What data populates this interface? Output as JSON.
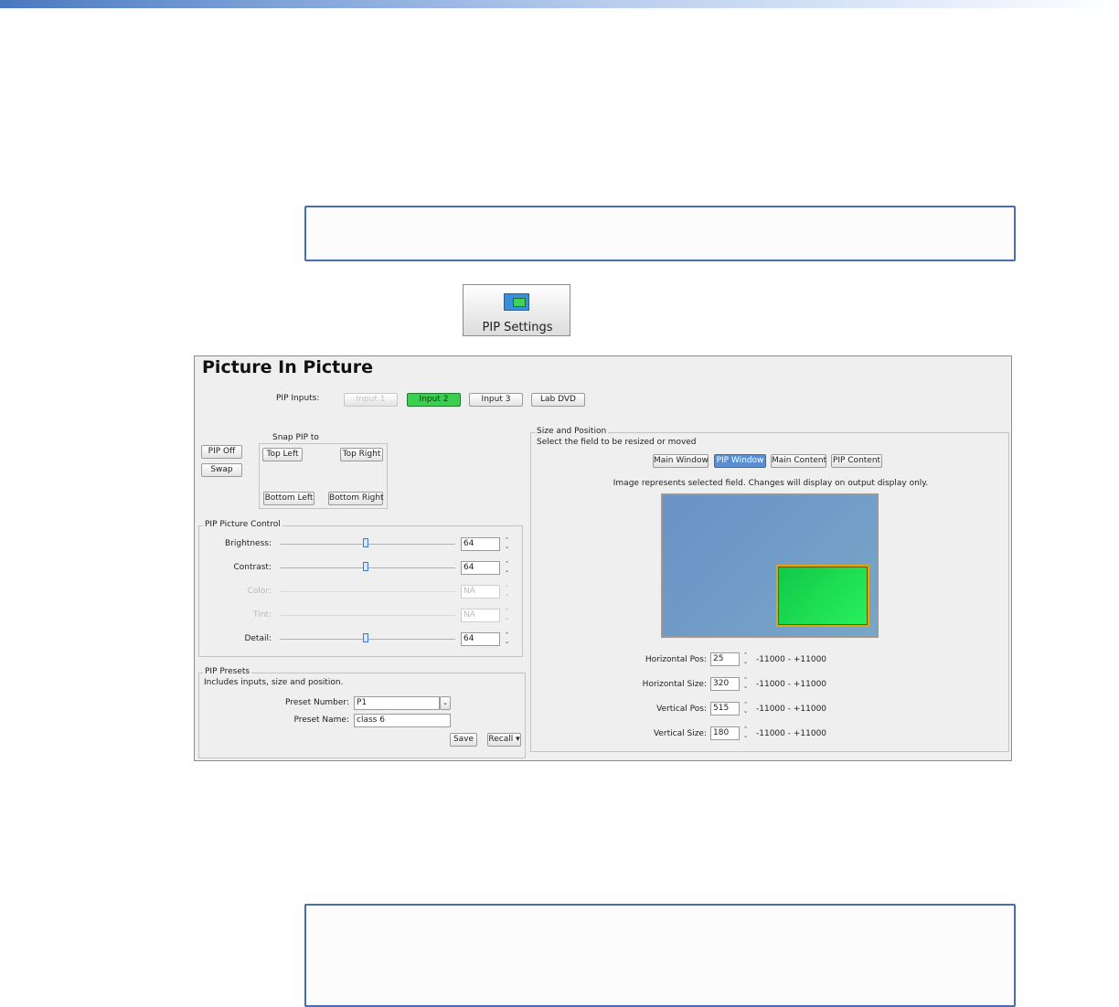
{
  "toolbar": {
    "pip_settings_label": "PIP Settings"
  },
  "panel": {
    "title": "Picture In Picture",
    "pip_inputs_label": "PIP Inputs:",
    "inputs": [
      "Input 1",
      "Input 2",
      "Input 3",
      "Lab DVD"
    ],
    "selected_input": "Input 2",
    "pip_off_label": "PIP Off",
    "swap_label": "Swap",
    "snap_label": "Snap PIP to",
    "snap": {
      "top_left": "Top Left",
      "top_right": "Top Right",
      "bottom_left": "Bottom Left",
      "bottom_right": "Bottom Right"
    },
    "picture_control": {
      "title": "PIP Picture Control",
      "brightness": {
        "label": "Brightness:",
        "value": "64"
      },
      "contrast": {
        "label": "Contrast:",
        "value": "64"
      },
      "color": {
        "label": "Color:",
        "value": "NA"
      },
      "tint": {
        "label": "Tint:",
        "value": "NA"
      },
      "detail": {
        "label": "Detail:",
        "value": "64"
      }
    },
    "presets": {
      "title": "PIP Presets",
      "subtitle": "Includes inputs, size and position.",
      "number_label": "Preset Number:",
      "number_value": "P1",
      "name_label": "Preset Name:",
      "name_value": "class 6",
      "save_label": "Save",
      "recall_label": "Recall ▾"
    },
    "size_position": {
      "title": "Size and Position",
      "subtitle": "Select the field to be resized or moved",
      "tabs": [
        "Main Window",
        "PIP Window",
        "Main Content",
        "PIP Content"
      ],
      "selected_tab": "PIP Window",
      "note": "Image represents selected field. Changes will display on output display only.",
      "h_pos": {
        "label": "Horizontal Pos:",
        "value": "25",
        "range": "-11000 - +11000"
      },
      "h_size": {
        "label": "Horizontal Size:",
        "value": "320",
        "range": "-11000 - +11000"
      },
      "v_pos": {
        "label": "Vertical Pos:",
        "value": "515",
        "range": "-11000 - +11000"
      },
      "v_size": {
        "label": "Vertical Size:",
        "value": "180",
        "range": "-11000 - +11000"
      }
    }
  },
  "colors": {
    "selected_input": "#38d04e",
    "selected_tab": "#5a8ed0",
    "preview_bg": "#6a98c4",
    "pip_window": "#22e84a",
    "pip_border": "#e0a800"
  }
}
